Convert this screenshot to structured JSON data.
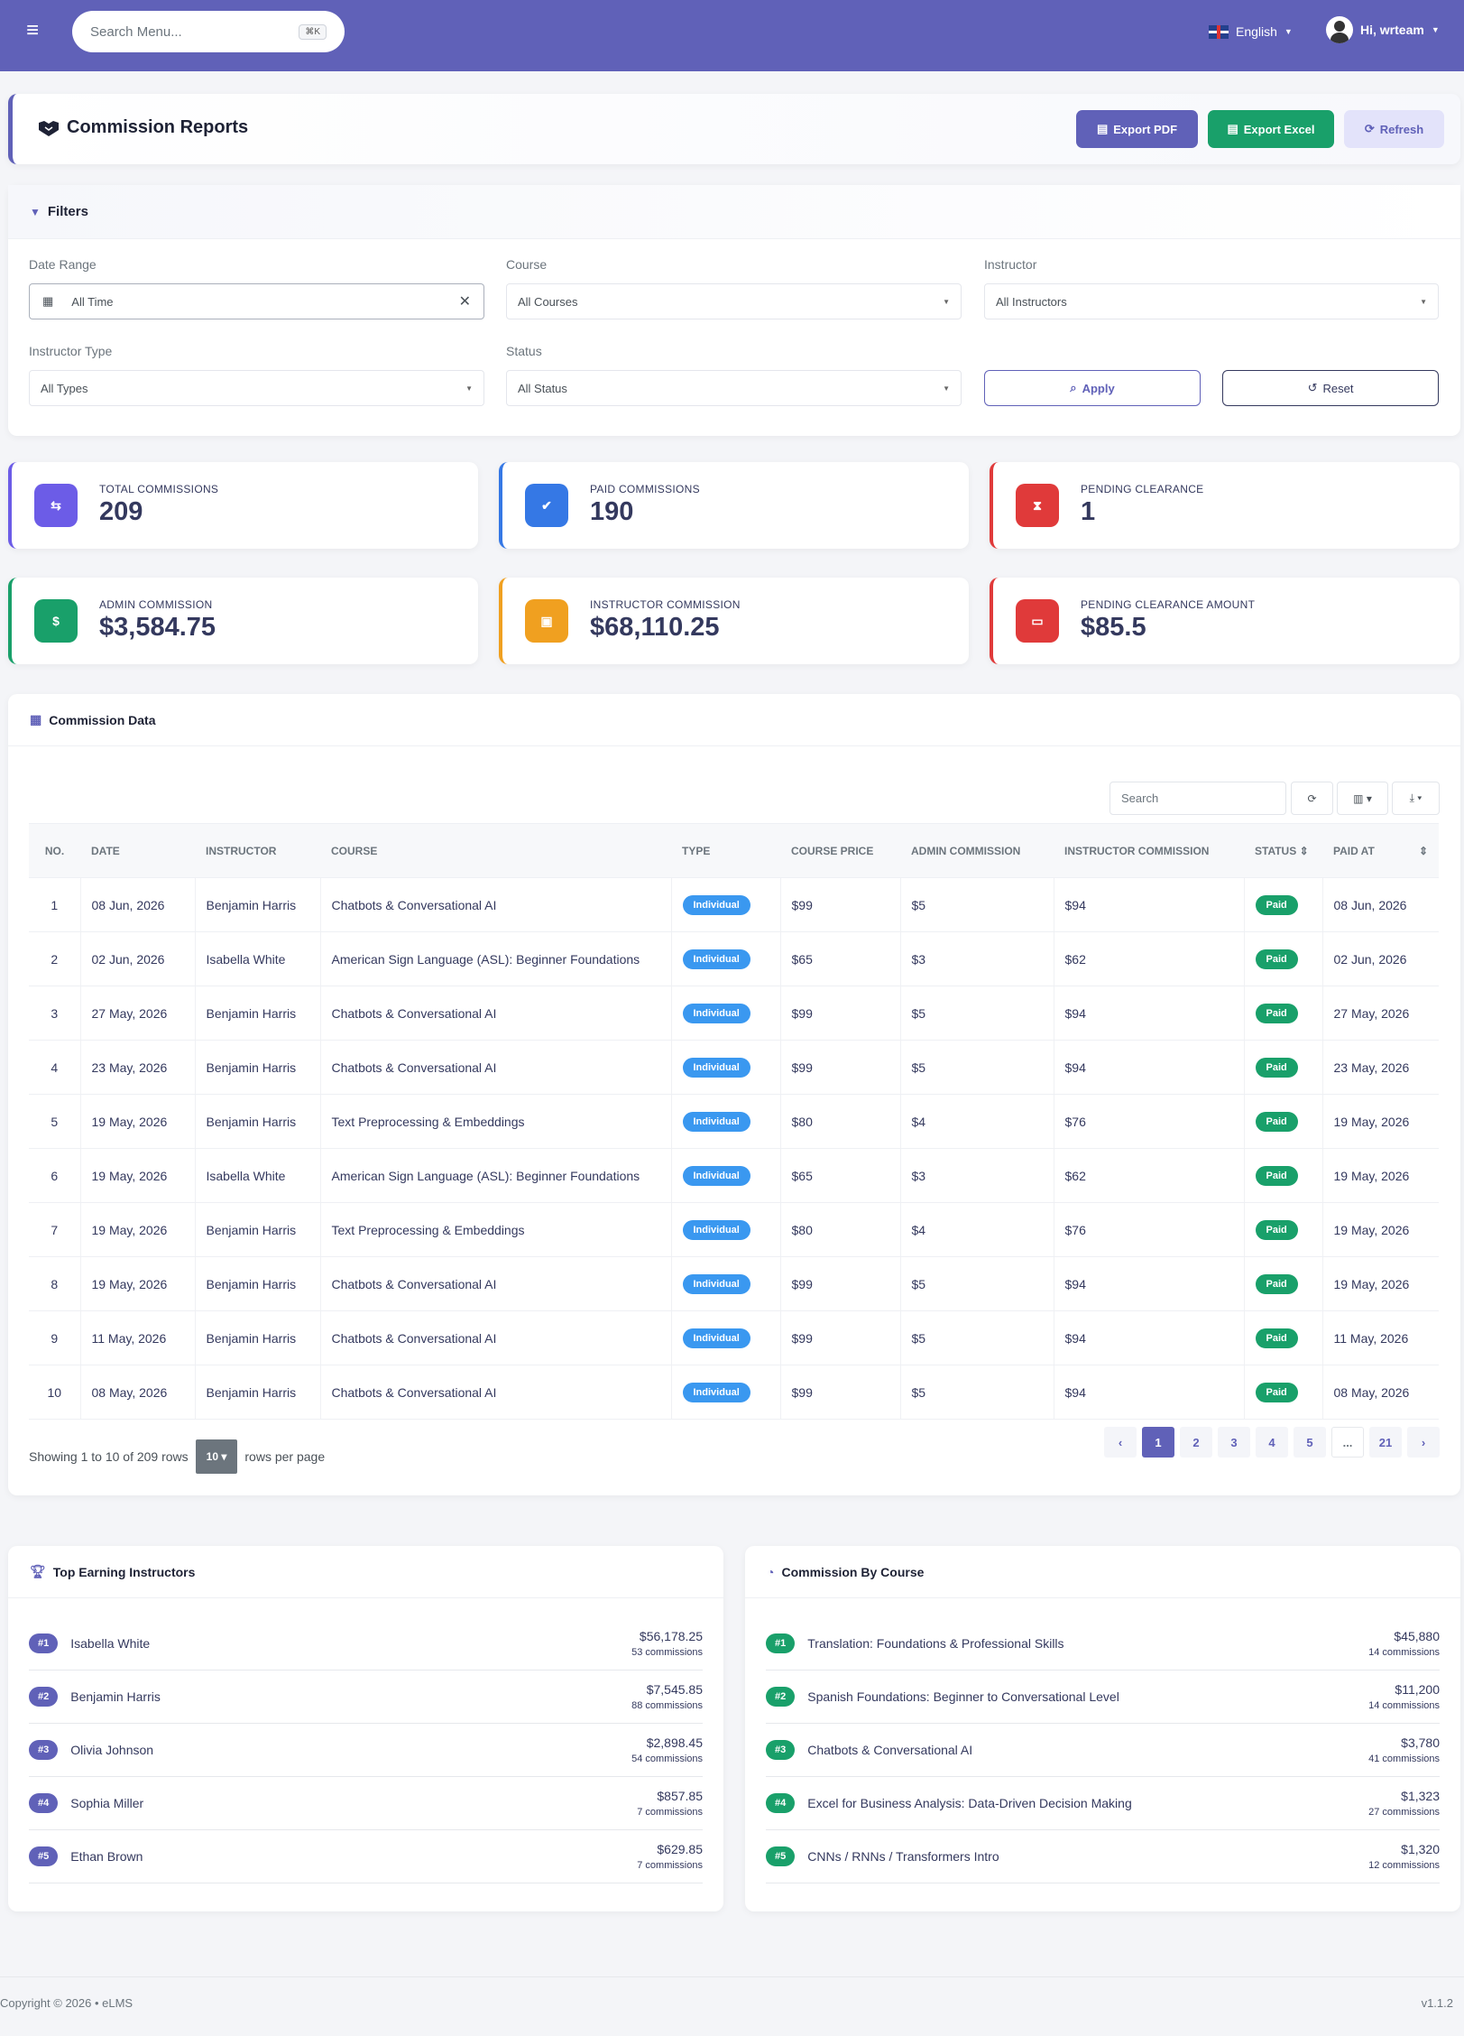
{
  "topbar": {
    "search_placeholder": "Search Menu...",
    "shortcut": "⌘K",
    "language": "English",
    "user": "Hi, wrteam"
  },
  "header": {
    "title": "Commission Reports",
    "export_pdf": "Export PDF",
    "export_excel": "Export Excel",
    "refresh": "Refresh"
  },
  "filters": {
    "title": "Filters",
    "date_label": "Date Range",
    "date_value": "All Time",
    "course_label": "Course",
    "course_value": "All Courses",
    "instructor_label": "Instructor",
    "instructor_value": "All Instructors",
    "type_label": "Instructor Type",
    "type_value": "All Types",
    "status_label": "Status",
    "status_value": "All Status",
    "apply": "Apply",
    "reset": "Reset"
  },
  "stats": [
    {
      "label": "Total Commissions",
      "value": "209",
      "color": "#6c5ce7"
    },
    {
      "label": "Paid Commissions",
      "value": "190",
      "color": "#3578e5"
    },
    {
      "label": "Pending Clearance",
      "value": "1",
      "color": "#e03a3a"
    },
    {
      "label": "Admin Commission",
      "value": "$3,584.75",
      "color": "#19a06a"
    },
    {
      "label": "Instructor Commission",
      "value": "$68,110.25",
      "color": "#f0a020"
    },
    {
      "label": "Pending Clearance Amount",
      "value": "$85.5",
      "color": "#e03a3a"
    }
  ],
  "table": {
    "title": "Commission Data",
    "search_placeholder": "Search",
    "columns": [
      "No.",
      "Date",
      "Instructor",
      "Course",
      "Type",
      "Course Price",
      "Admin Commission",
      "Instructor Commission",
      "Status",
      "Paid At"
    ],
    "rows": [
      [
        "1",
        "08 Jun, 2026",
        "Benjamin Harris",
        "Chatbots & Conversational AI",
        "Individual",
        "$99",
        "$5",
        "$94",
        "Paid",
        "08 Jun, 2026"
      ],
      [
        "2",
        "02 Jun, 2026",
        "Isabella White",
        "American Sign Language (ASL): Beginner Foundations",
        "Individual",
        "$65",
        "$3",
        "$62",
        "Paid",
        "02 Jun, 2026"
      ],
      [
        "3",
        "27 May, 2026",
        "Benjamin Harris",
        "Chatbots & Conversational AI",
        "Individual",
        "$99",
        "$5",
        "$94",
        "Paid",
        "27 May, 2026"
      ],
      [
        "4",
        "23 May, 2026",
        "Benjamin Harris",
        "Chatbots & Conversational AI",
        "Individual",
        "$99",
        "$5",
        "$94",
        "Paid",
        "23 May, 2026"
      ],
      [
        "5",
        "19 May, 2026",
        "Benjamin Harris",
        "Text Preprocessing & Embeddings",
        "Individual",
        "$80",
        "$4",
        "$76",
        "Paid",
        "19 May, 2026"
      ],
      [
        "6",
        "19 May, 2026",
        "Isabella White",
        "American Sign Language (ASL): Beginner Foundations",
        "Individual",
        "$65",
        "$3",
        "$62",
        "Paid",
        "19 May, 2026"
      ],
      [
        "7",
        "19 May, 2026",
        "Benjamin Harris",
        "Text Preprocessing & Embeddings",
        "Individual",
        "$80",
        "$4",
        "$76",
        "Paid",
        "19 May, 2026"
      ],
      [
        "8",
        "19 May, 2026",
        "Benjamin Harris",
        "Chatbots & Conversational AI",
        "Individual",
        "$99",
        "$5",
        "$94",
        "Paid",
        "19 May, 2026"
      ],
      [
        "9",
        "11 May, 2026",
        "Benjamin Harris",
        "Chatbots & Conversational AI",
        "Individual",
        "$99",
        "$5",
        "$94",
        "Paid",
        "11 May, 2026"
      ],
      [
        "10",
        "08 May, 2026",
        "Benjamin Harris",
        "Chatbots & Conversational AI",
        "Individual",
        "$99",
        "$5",
        "$94",
        "Paid",
        "08 May, 2026"
      ]
    ],
    "showing": "Showing 1 to 10 of 209 rows",
    "per_page": "10",
    "per_page_suffix": "rows per page",
    "pages": [
      "‹",
      "1",
      "2",
      "3",
      "4",
      "5",
      "...",
      "21",
      "›"
    ]
  },
  "top_instructors": {
    "title": "Top Earning Instructors",
    "items": [
      {
        "rank": "#1",
        "name": "Isabella White",
        "amount": "$56,178.25",
        "count": "53 commissions"
      },
      {
        "rank": "#2",
        "name": "Benjamin Harris",
        "amount": "$7,545.85",
        "count": "88 commissions"
      },
      {
        "rank": "#3",
        "name": "Olivia Johnson",
        "amount": "$2,898.45",
        "count": "54 commissions"
      },
      {
        "rank": "#4",
        "name": "Sophia Miller",
        "amount": "$857.85",
        "count": "7 commissions"
      },
      {
        "rank": "#5",
        "name": "Ethan Brown",
        "amount": "$629.85",
        "count": "7 commissions"
      }
    ]
  },
  "by_course": {
    "title": "Commission By Course",
    "items": [
      {
        "rank": "#1",
        "name": "Translation: Foundations & Professional Skills",
        "amount": "$45,880",
        "count": "14 commissions"
      },
      {
        "rank": "#2",
        "name": "Spanish Foundations: Beginner to Conversational Level",
        "amount": "$11,200",
        "count": "14 commissions"
      },
      {
        "rank": "#3",
        "name": "Chatbots & Conversational AI",
        "amount": "$3,780",
        "count": "41 commissions"
      },
      {
        "rank": "#4",
        "name": "Excel for Business Analysis: Data-Driven Decision Making",
        "amount": "$1,323",
        "count": "27 commissions"
      },
      {
        "rank": "#5",
        "name": "CNNs / RNNs / Transformers Intro",
        "amount": "$1,320",
        "count": "12 commissions"
      }
    ]
  },
  "footer": {
    "copyright": "Copyright © 2026 • eLMS",
    "version": "v1.1.2"
  }
}
